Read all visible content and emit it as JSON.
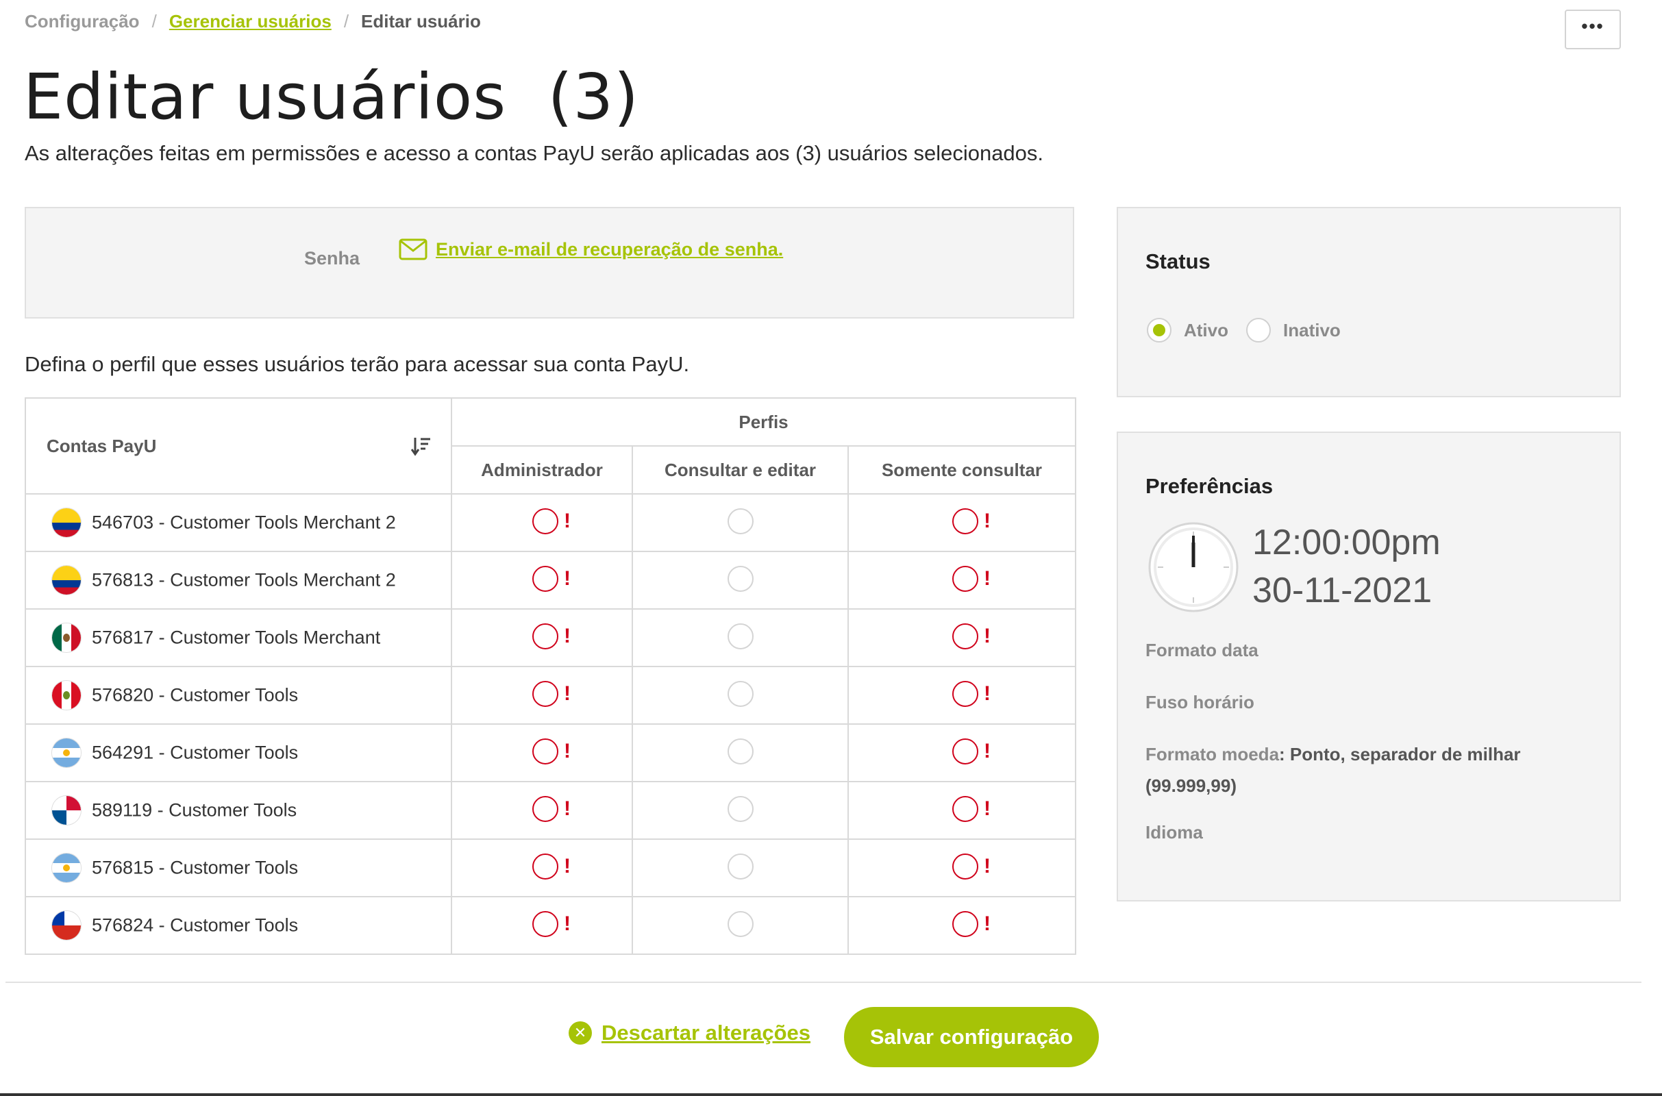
{
  "breadcrumb": {
    "items": [
      "Configuração",
      "Gerenciar usuários",
      "Editar usuário"
    ],
    "separator": "/"
  },
  "header": {
    "more_label": "•••",
    "title": "Editar usuários  (3)",
    "subtitle": "As alterações feitas em permissões e acesso a contas PayU serão aplicadas aos (3) usuários selecionados."
  },
  "password": {
    "label": "Senha",
    "link": "Enviar e-mail de recuperação de senha.",
    "icon": "mail-icon"
  },
  "profile_intro": "Defina o perfil que esses usuários terão para acessar sua conta PayU.",
  "table": {
    "account_header": "Contas PayU",
    "profiles_header": "Perfis",
    "roles": [
      "Administrador",
      "Consultar e editar",
      "Somente consultar"
    ],
    "rows": [
      {
        "label": "546703 - Customer Tools Merchant 2",
        "flag": "colombia"
      },
      {
        "label": "576813 - Customer Tools Merchant 2",
        "flag": "colombia"
      },
      {
        "label": "576817 - Customer Tools Merchant",
        "flag": "mexico"
      },
      {
        "label": "576820 - Customer Tools",
        "flag": "peru"
      },
      {
        "label": "564291 - Customer Tools",
        "flag": "argentina"
      },
      {
        "label": "589119 - Customer Tools",
        "flag": "panama"
      },
      {
        "label": "576815 - Customer Tools",
        "flag": "argentina"
      },
      {
        "label": "576824 - Customer Tools",
        "flag": "chile"
      }
    ],
    "error_mark": "!"
  },
  "status": {
    "title": "Status",
    "options": [
      "Ativo",
      "Inativo"
    ],
    "selected": "Ativo"
  },
  "preferences": {
    "title": "Preferências",
    "time": "12:00:00pm",
    "date": "30-11-2021",
    "date_format_label": "Formato data",
    "timezone_label": "Fuso horário",
    "currency_format_label": "Formato moeda",
    "currency_format_value": ": Ponto, separador de milhar",
    "currency_format_example": "(99.999,99)",
    "language_label": "Idioma"
  },
  "footer": {
    "discard_label": "Descartar alterações",
    "save_label": "Salvar configuração"
  },
  "colors": {
    "accent": "#a6c307",
    "error": "#d0021b"
  }
}
